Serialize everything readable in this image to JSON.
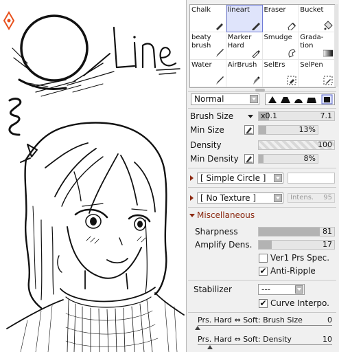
{
  "canvas": {
    "drawn_text": "Line"
  },
  "tools": [
    {
      "label": "Chalk",
      "icon": "chalk-icon"
    },
    {
      "label": "lineart",
      "icon": "pen-icon",
      "selected": true
    },
    {
      "label": "Eraser",
      "icon": "eraser-icon"
    },
    {
      "label": "Bucket",
      "icon": "bucket-icon"
    },
    {
      "label": "beaty\nbrush",
      "icon": "brush-icon"
    },
    {
      "label": "Marker\nHard",
      "icon": "marker-icon"
    },
    {
      "label": "Smudge",
      "icon": "smudge-icon"
    },
    {
      "label": "Grada-\ntion",
      "icon": "gradation-icon"
    },
    {
      "label": "Water",
      "icon": "water-icon"
    },
    {
      "label": "AirBrush",
      "icon": "airbrush-icon"
    },
    {
      "label": "SelErs",
      "icon": "selection-eraser-icon"
    },
    {
      "label": "SelPen",
      "icon": "selection-pen-icon"
    }
  ],
  "blend_mode": "Normal",
  "brush_size": {
    "label": "Brush Size",
    "multiplier": "x0.1",
    "value": "7.1"
  },
  "min_size": {
    "label": "Min Size",
    "value": "13%",
    "fraction": 0.13
  },
  "density": {
    "label": "Density",
    "value": "100",
    "fraction": 1.0
  },
  "min_density": {
    "label": "Min Density",
    "value": "8%",
    "fraction": 0.08
  },
  "shape": {
    "value": "[ Simple Circle ]"
  },
  "texture": {
    "value": "[ No Texture ]",
    "intens_label": "Intens.",
    "intens_value": "95"
  },
  "misc": {
    "label": "Miscellaneous"
  },
  "sharpness": {
    "label": "Sharpness",
    "value": "81",
    "fraction": 0.81
  },
  "amplify": {
    "label": "Amplify Dens.",
    "value": "17",
    "fraction": 0.17
  },
  "ver1": {
    "label": "Ver1 Prs Spec.",
    "checked": false
  },
  "anti_ripple": {
    "label": "Anti-Ripple",
    "checked": true
  },
  "stabilizer": {
    "label": "Stabilizer",
    "value": "---"
  },
  "curve_interp": {
    "label": "Curve Interpo.",
    "checked": true
  },
  "prs_brush": {
    "label": "Prs. Hard ⇔ Soft: Brush Size",
    "value": "0"
  },
  "prs_density": {
    "label": "Prs. Hard ⇔ Soft: Density",
    "value": "10"
  },
  "check_mark": "✔",
  "colors": {
    "accent": "#e8501c",
    "selected_tool": "#dfe4fb",
    "slider_fill": "#b3b3b3"
  }
}
